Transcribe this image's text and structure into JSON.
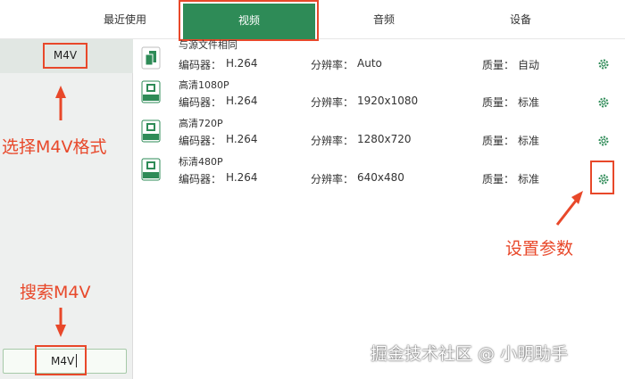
{
  "tabs": [
    {
      "label": "最近使用"
    },
    {
      "label": "视频"
    },
    {
      "label": "音频"
    },
    {
      "label": "设备"
    }
  ],
  "left_panel": {
    "selected_format": "M4V",
    "search_value": "M4V"
  },
  "field_labels": {
    "encoder": "编码器：",
    "resolution": "分辨率：",
    "quality": "质量："
  },
  "presets": [
    {
      "title": "与源文件相同",
      "badge": "",
      "encoder": "H.264",
      "resolution": "Auto",
      "quality": "自动"
    },
    {
      "title": "高清1080P",
      "badge": "1080P",
      "encoder": "H.264",
      "resolution": "1920x1080",
      "quality": "标准"
    },
    {
      "title": "高清720P",
      "badge": "720P",
      "encoder": "H.264",
      "resolution": "1280x720",
      "quality": "标准"
    },
    {
      "title": "标清480P",
      "badge": "480P",
      "encoder": "H.264",
      "resolution": "640x480",
      "quality": "标准"
    }
  ],
  "annotations": {
    "select_format": "选择M4V格式",
    "search": "搜索M4V",
    "set_params": "设置参数"
  },
  "watermark": "掘金技术社区 @ 小明助手",
  "colors": {
    "accent_green": "#2e8b57",
    "annotation_red": "#e8482a"
  },
  "icons": [
    "file-video-icon",
    "gear-icon",
    "arrow-icon"
  ]
}
